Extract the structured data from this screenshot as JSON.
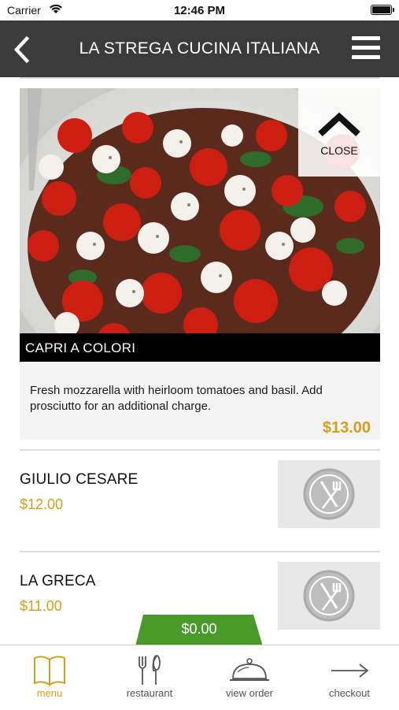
{
  "status": {
    "carrier": "Carrier",
    "time": "12:46 PM"
  },
  "header": {
    "title": "LA STREGA CUCINA ITALIANA"
  },
  "expanded_item": {
    "close_label": "CLOSE",
    "name": "CAPRI A COLORI",
    "description": "Fresh mozzarella with heirloom tomatoes and basil. Add prosciutto for an additional charge.",
    "price": "$13.00"
  },
  "items": [
    {
      "name": "GIULIO CESARE",
      "price": "$12.00"
    },
    {
      "name": "LA GRECA",
      "price": "$11.00"
    }
  ],
  "cart": {
    "total": "$0.00"
  },
  "tabs": [
    {
      "label": "menu",
      "icon": "book-icon",
      "active": true
    },
    {
      "label": "restaurant",
      "icon": "fork-knife-icon",
      "active": false
    },
    {
      "label": "view order",
      "icon": "cloche-icon",
      "active": false
    },
    {
      "label": "checkout",
      "icon": "arrow-right-icon",
      "active": false
    }
  ],
  "colors": {
    "nav": "#3b3b3b",
    "accent": "#d4a017",
    "cart": "#4a9a2a"
  }
}
